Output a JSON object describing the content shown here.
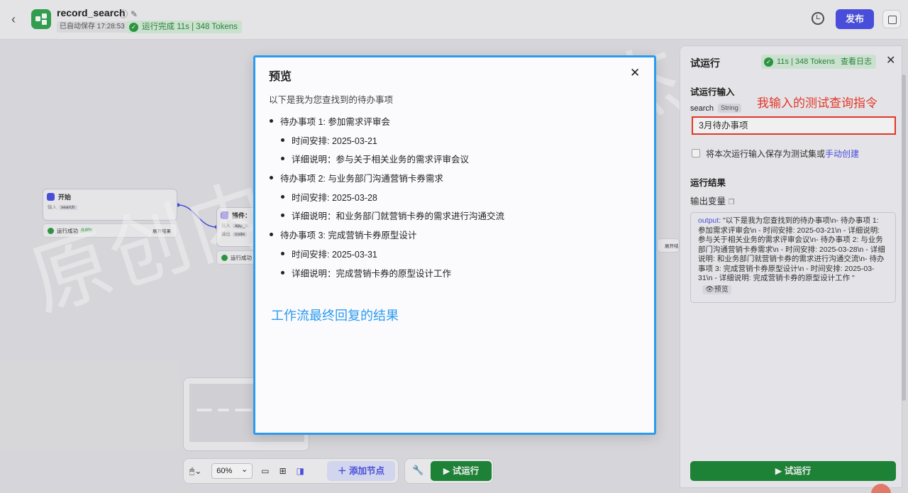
{
  "header": {
    "back_icon": "chevron-left-icon",
    "title": "record_search",
    "autosave": "已自动保存 17:28:53",
    "run_status": "运行完成 11s | 348 Tokens",
    "publish_label": "发布"
  },
  "canvas": {
    "start_node": {
      "title": "开始",
      "input_label": "输入",
      "input_chip": "search",
      "status": "运行成功",
      "pct": "0.00s",
      "expand": "展开结果"
    },
    "plugin_node": {
      "title": "插件：",
      "row1_label": "输入",
      "row1_chip": "app_s",
      "row2_label": "输出",
      "row2_chip": "code",
      "status": "运行成功"
    },
    "side_expand": "展开结",
    "toolbar": {
      "zoom": "60%",
      "add_node_label": "添加节点",
      "run_label": "试运行"
    },
    "watermark": "原创内容BY笛仁杰"
  },
  "panel": {
    "title": "试运行",
    "badge_stats": "11s | 348 Tokens",
    "badge_link": "查看日志",
    "input_section": "试运行输入",
    "field_name": "search",
    "field_type": "String",
    "field_value": "3月待办事项",
    "annotation": "我输入的测试查询指令",
    "save_text": "将本次运行输入保存为测试集或",
    "save_link": "手动创建",
    "result_section": "运行结果",
    "output_var_label": "输出变量",
    "output_key": "output",
    "output_value": ": \"以下是我为您查找到的待办事项\\n- 待办事项 1: 参加需求评审会\\n  - 时间安排: 2025-03-21\\n  - 详细说明: 参与关于相关业务的需求评审会议\\n- 待办事项 2: 与业务部门沟通营销卡券需求\\n  - 时间安排: 2025-03-28\\n  - 详细说明: 和业务部门就营销卡券的需求进行沟通交流\\n- 待办事项 3: 完成营销卡券原型设计\\n  - 时间安排: 2025-03-31\\n  - 详细说明: 完成营销卡券的原型设计工作 \"",
    "preview_label": "预览",
    "run_label": "试运行"
  },
  "modal": {
    "title": "预览",
    "intro": "以下是我为您查找到的待办事项",
    "todos": [
      {
        "title": "待办事项 1: 参加需求评审会",
        "time": "时间安排: 2025-03-21",
        "detail": "详细说明：参与关于相关业务的需求评审会议"
      },
      {
        "title": "待办事项 2: 与业务部门沟通营销卡券需求",
        "time": "时间安排: 2025-03-28",
        "detail": "详细说明：和业务部门就营销卡券的需求进行沟通交流"
      },
      {
        "title": "待办事项 3: 完成营销卡券原型设计",
        "time": "时间安排: 2025-03-31",
        "detail": "详细说明：完成营销卡券的原型设计工作"
      }
    ],
    "annotation": "工作流最终回复的结果"
  },
  "colors": {
    "accent": "#4d53e8",
    "success": "#1f8a3a",
    "annotation_red": "#f23a2a",
    "annotation_blue": "#2b9bf0"
  }
}
